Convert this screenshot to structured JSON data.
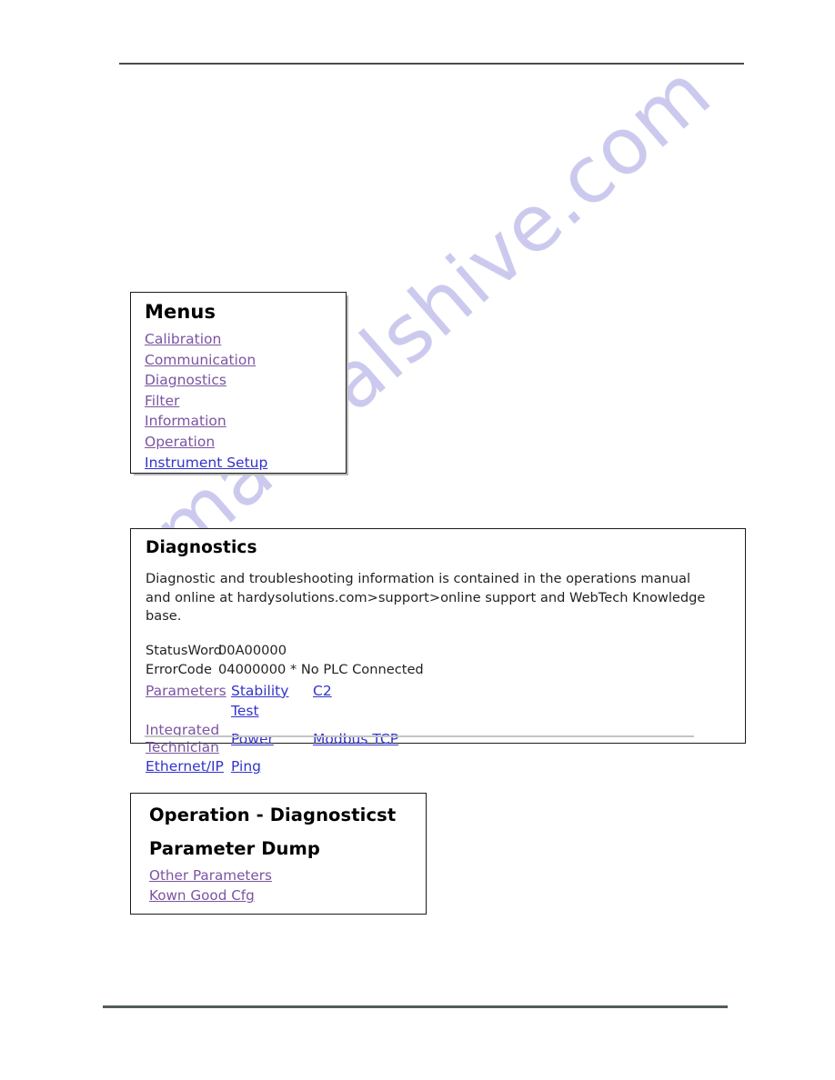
{
  "page": {
    "background_color": "#ffffff",
    "watermark_text": "manualshive.com",
    "watermark_color": "#c9c8ee",
    "rule_color_top": "#4b4b4f",
    "rule_color_bottom": "#525c58"
  },
  "colors": {
    "link_purple": "#7b54a3",
    "link_blue": "#3333cc",
    "heading": "#000000",
    "body_text": "#231f20",
    "panel_border": "#1b1b1b",
    "inner_rule": "#c4c4c4"
  },
  "menus_panel": {
    "heading": "Menus",
    "items": [
      {
        "label": "Calibration",
        "color": "purple"
      },
      {
        "label": "Communication",
        "color": "purple"
      },
      {
        "label": "Diagnostics",
        "color": "purple"
      },
      {
        "label": "Filter",
        "color": "purple"
      },
      {
        "label": "Information",
        "color": "purple"
      },
      {
        "label": "Operation",
        "color": "purple"
      },
      {
        "label": "Instrument Setup",
        "color": "blue"
      }
    ]
  },
  "diagnostics_panel": {
    "heading": "Diagnostics",
    "description_line_1": "Diagnostic and troubleshooting information is contained in the operations manual",
    "description_line_2": "and online at hardysolutions.com>support>online support and WebTech Knowledge base.",
    "status": {
      "status_word_label": "StatusWord",
      "status_word_value": "00A00000",
      "error_code_label": "ErrorCode",
      "error_code_value": "04000000 * No PLC Connected"
    },
    "links": {
      "parameters": "Parameters",
      "stability_test": "Stability Test",
      "c2": "C2",
      "integrated_line_1": "Integrated",
      "integrated_line_2": "Technician",
      "power": "Power",
      "modbus_tcp": "Modbus TCP",
      "ethernet_ip": "Ethernet/IP",
      "ping": "Ping"
    }
  },
  "operation_panel": {
    "heading_1": "Operation - Diagnosticst",
    "heading_2": "Parameter Dump",
    "links": [
      {
        "label": "Other Parameters",
        "color": "purple"
      },
      {
        "label": "Kown Good Cfg",
        "color": "purple"
      }
    ]
  }
}
